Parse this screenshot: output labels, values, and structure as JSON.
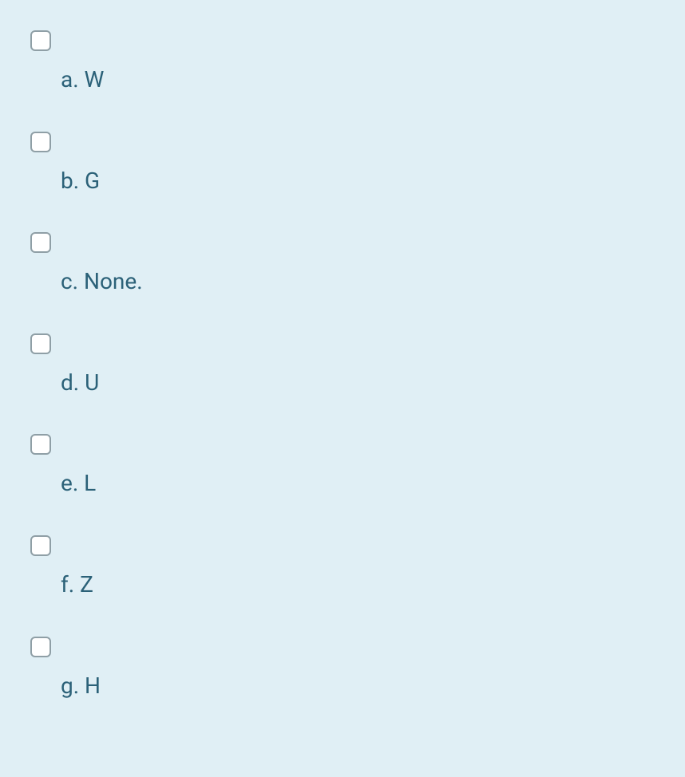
{
  "options": [
    {
      "letter": "a",
      "text": "W",
      "checked": false
    },
    {
      "letter": "b",
      "text": "G",
      "checked": false
    },
    {
      "letter": "c",
      "text": "None.",
      "checked": false
    },
    {
      "letter": "d",
      "text": "U",
      "checked": false
    },
    {
      "letter": "e",
      "text": "L",
      "checked": false
    },
    {
      "letter": "f",
      "text": "Z",
      "checked": false
    },
    {
      "letter": "g",
      "text": "H",
      "checked": false
    }
  ]
}
